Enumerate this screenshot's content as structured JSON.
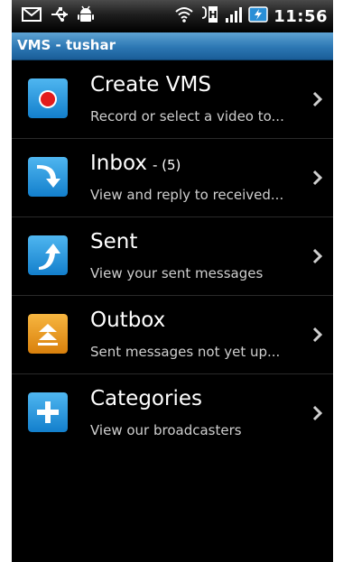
{
  "status_bar": {
    "time": "11:56",
    "left_icons": [
      "gmail-icon",
      "usb-icon",
      "android-debug-icon"
    ],
    "right_icons": [
      "wifi-icon",
      "data-transfer-icon",
      "signal-icon",
      "battery-icon"
    ]
  },
  "title_bar": {
    "title": "VMS - tushar"
  },
  "menu": {
    "items": [
      {
        "title": "Create VMS",
        "count": "",
        "subtitle": "Record or select a video to...",
        "icon": "record-icon",
        "icon_color": "#1f9be6"
      },
      {
        "title": "Inbox",
        "count": "- (5)",
        "subtitle": "View and reply to received...",
        "icon": "inbox-arrow-icon",
        "icon_color": "#1f9be6"
      },
      {
        "title": "Sent",
        "count": "",
        "subtitle": "View your sent messages",
        "icon": "sent-arrow-icon",
        "icon_color": "#1f9be6"
      },
      {
        "title": "Outbox",
        "count": "",
        "subtitle": "Sent messages not yet up...",
        "icon": "outbox-upload-icon",
        "icon_color": "#e8961a"
      },
      {
        "title": "Categories",
        "count": "",
        "subtitle": "View our broadcasters",
        "icon": "plus-icon",
        "icon_color": "#1f9be6"
      }
    ]
  }
}
